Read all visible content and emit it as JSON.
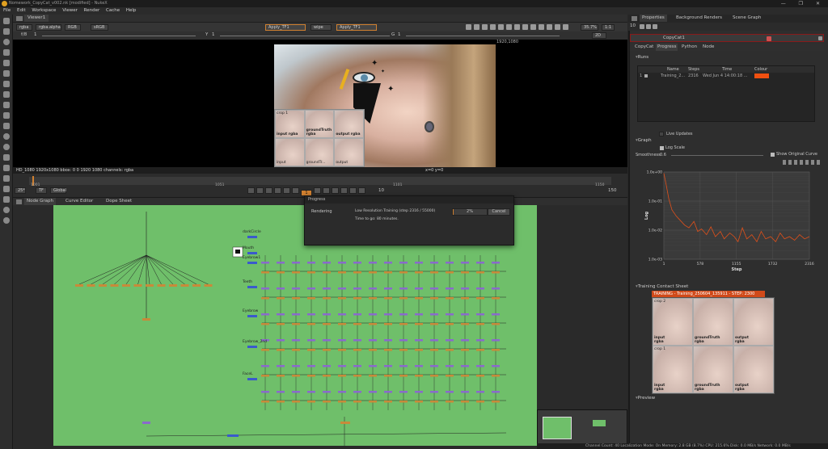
{
  "window": {
    "title": "Nomework_CopyCat_v002.nk [modified] - NukeX",
    "controls": "— ❐ ✕"
  },
  "menu": [
    "File",
    "Edit",
    "Workspace",
    "Viewer",
    "Render",
    "Cache",
    "Help"
  ],
  "viewer": {
    "tab": "Viewer1",
    "channels": "rgba",
    "alpha": "rgba.alpha",
    "colorspace": "RGB",
    "input_space": "sRGB",
    "input_a": "Apply_TF1",
    "wipe": "wipe",
    "input_b": "Apply_TF1",
    "zoom": "35.7%",
    "ratio": "1:1",
    "view": "2D",
    "frame_in": "f/8",
    "gain": "1",
    "gamma_label": "Y",
    "gamma": "1",
    "proxy_label": "G",
    "proxy": "1",
    "resolution": "1920,1080",
    "status": "HD_1080 1920x1080  bbox: 0 0 1920 1080 channels: rgba",
    "coords": "x=0 y=0"
  },
  "contact_viewer": {
    "label": "crop 1",
    "tiles": [
      {
        "line1": "input",
        "line2": "rgba"
      },
      {
        "line1": "groundTruth",
        "line2": "rgba"
      },
      {
        "line1": "output",
        "line2": "rgba"
      },
      {
        "line1": "input",
        "line2": ""
      },
      {
        "line1": "groundTr...",
        "line2": ""
      },
      {
        "line1": "output",
        "line2": ""
      }
    ]
  },
  "timeline": {
    "ticks": [
      "1001",
      "1051",
      "1101",
      "1150"
    ],
    "fps": "25*",
    "tf": "TF",
    "scope": "Global",
    "current_frame": "1",
    "step": "10",
    "end": "150"
  },
  "node_tabs": [
    "Node Graph",
    "Curve Editor",
    "Dope Sheet"
  ],
  "graph_labels": [
    "darkCircle",
    "Mouth",
    "Eyebrow1",
    "Teeth",
    "Eyebrow",
    "Eyebrow_2nd",
    "FaceL"
  ],
  "progress": {
    "title": "Progress",
    "task": "Rendering",
    "detail": "Low Resolution Training (step 2316 / 55000)",
    "time_left": "Time to go: 80 minutes.",
    "percent_text": "2%",
    "percent_value": 0.02,
    "cancel": "Cancel"
  },
  "properties": {
    "tabs": [
      "Properties",
      "Background Renders",
      "Scene Graph"
    ],
    "count": "10",
    "node_name": "CopyCat1",
    "subtabs": [
      "CopyCat",
      "Progress",
      "Python",
      "Node"
    ],
    "runs_title": "Runs",
    "runs_headers": [
      "Name",
      "Steps",
      "Time",
      "Colour"
    ],
    "runs": [
      {
        "index": "1",
        "name": "Training_2...",
        "steps": "2316",
        "time": "Wed Jun 4 14:00:18 ...",
        "colour": "#f05010"
      }
    ],
    "live_updates": "Live Updates",
    "graph_title": "Graph",
    "log_scale": "Log Scale",
    "smoothness_label": "Smoothness",
    "smoothness": "0.6",
    "show_original": "Show Original Curve",
    "contact_title": "Training Contact Sheet",
    "contact_banner": "TRAINING - Training_250604_135911 - STEP: 2300",
    "contact_tiles": [
      {
        "line1": "crop 2",
        "line2": ""
      },
      {
        "line1": "",
        "line2": ""
      },
      {
        "line1": "",
        "line2": ""
      },
      {
        "line1": "crop 1",
        "line2": ""
      },
      {
        "line1": "",
        "line2": ""
      },
      {
        "line1": "",
        "line2": ""
      }
    ],
    "contact_labels": [
      {
        "line1": "input",
        "line2": "rgba"
      },
      {
        "line1": "groundTruth",
        "line2": "rgba"
      },
      {
        "line1": "output",
        "line2": "rgba"
      },
      {
        "line1": "input",
        "line2": "rgba"
      },
      {
        "line1": "groundTruth",
        "line2": "rgba"
      },
      {
        "line1": "output",
        "line2": "rgba"
      }
    ],
    "preview_title": "Preview"
  },
  "chart_data": {
    "type": "line",
    "xlabel": "Step",
    "ylabel": "Log",
    "x_ticks": [
      "1",
      "578",
      "1155",
      "1732",
      "2316"
    ],
    "y_ticks": [
      "1.0e+00",
      "1.0e-01",
      "1.0e-02",
      "1.0e-03"
    ],
    "xlim": [
      1,
      2316
    ],
    "log_y": true,
    "color": "#e0501a",
    "points": [
      [
        1,
        0.9
      ],
      [
        40,
        0.35
      ],
      [
        80,
        0.12
      ],
      [
        130,
        0.05
      ],
      [
        200,
        0.03
      ],
      [
        260,
        0.022
      ],
      [
        330,
        0.015
      ],
      [
        400,
        0.012
      ],
      [
        480,
        0.02
      ],
      [
        540,
        0.009
      ],
      [
        600,
        0.011
      ],
      [
        680,
        0.007
      ],
      [
        750,
        0.013
      ],
      [
        820,
        0.006
      ],
      [
        900,
        0.009
      ],
      [
        960,
        0.005
      ],
      [
        1050,
        0.008
      ],
      [
        1120,
        0.006
      ],
      [
        1180,
        0.004
      ],
      [
        1250,
        0.012
      ],
      [
        1320,
        0.005
      ],
      [
        1400,
        0.007
      ],
      [
        1480,
        0.004
      ],
      [
        1550,
        0.009
      ],
      [
        1620,
        0.005
      ],
      [
        1700,
        0.006
      ],
      [
        1780,
        0.004
      ],
      [
        1850,
        0.008
      ],
      [
        1920,
        0.005
      ],
      [
        2000,
        0.006
      ],
      [
        2080,
        0.0045
      ],
      [
        2160,
        0.007
      ],
      [
        2240,
        0.005
      ],
      [
        2316,
        0.006
      ]
    ]
  },
  "status_bar": "Channel Count: 40  Localization Mode: On  Memory: 2.8 GB (8.7%)  CPU: 215.6%  Disk: 0.0 MB/s  Network: 0.0 MB/s"
}
